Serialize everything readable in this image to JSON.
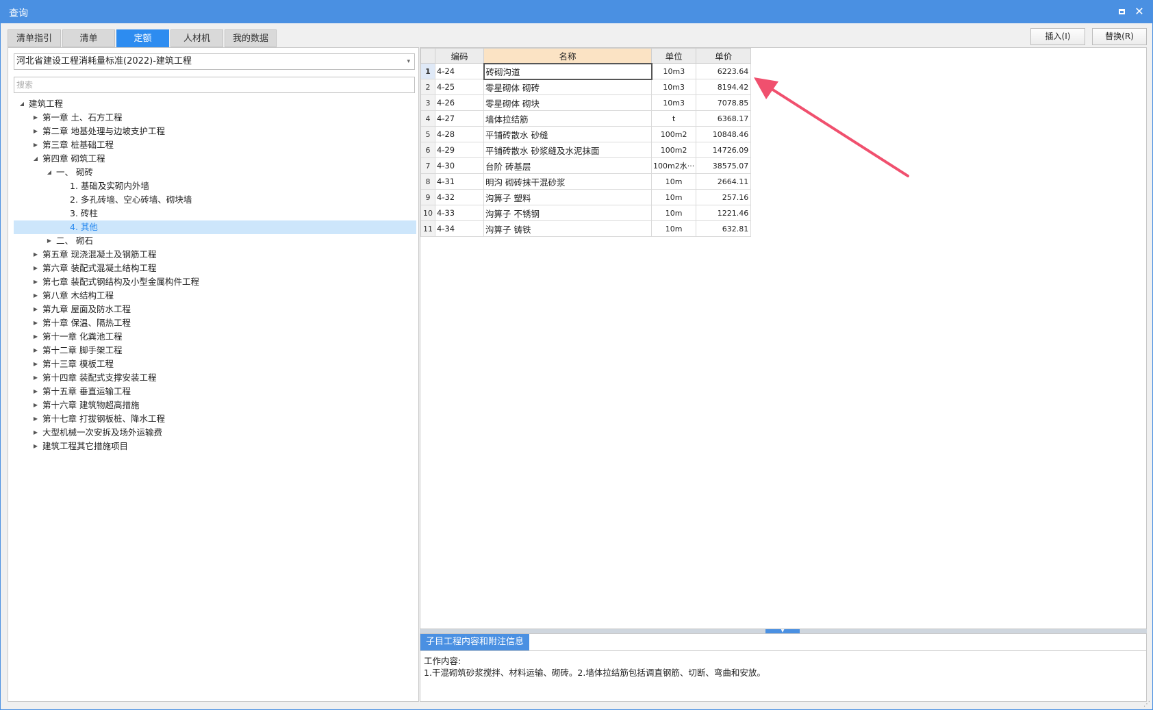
{
  "window": {
    "title": "查询",
    "maximize_glyph": "max-icon",
    "close_glyph": "✕"
  },
  "tabs": [
    "清单指引",
    "清单",
    "定额",
    "人材机",
    "我的数据"
  ],
  "active_tab_index": 2,
  "actions": {
    "insert_label": "插入(I)",
    "replace_label": "替换(R)"
  },
  "left": {
    "library": "河北省建设工程消耗量标准(2022)-建筑工程",
    "search_placeholder": "搜索",
    "tree": [
      {
        "label": "建筑工程",
        "level": 0,
        "state": "expanded"
      },
      {
        "label": "第一章 土、石方工程",
        "level": 1,
        "state": "collapsed"
      },
      {
        "label": "第二章 地基处理与边坡支护工程",
        "level": 1,
        "state": "collapsed"
      },
      {
        "label": "第三章 桩基础工程",
        "level": 1,
        "state": "collapsed"
      },
      {
        "label": "第四章 砌筑工程",
        "level": 1,
        "state": "expanded"
      },
      {
        "label": "一、 砌砖",
        "level": 2,
        "state": "expanded"
      },
      {
        "label": "1. 基础及实砌内外墙",
        "level": 3,
        "state": "leaf"
      },
      {
        "label": "2. 多孔砖墙、空心砖墙、砌块墙",
        "level": 3,
        "state": "leaf"
      },
      {
        "label": "3. 砖柱",
        "level": 3,
        "state": "leaf"
      },
      {
        "label": "4. 其他",
        "level": 3,
        "state": "leaf",
        "selected": true
      },
      {
        "label": "二、 砌石",
        "level": 2,
        "state": "collapsed"
      },
      {
        "label": "第五章 现浇混凝土及钢筋工程",
        "level": 1,
        "state": "collapsed"
      },
      {
        "label": "第六章 装配式混凝土结构工程",
        "level": 1,
        "state": "collapsed"
      },
      {
        "label": "第七章 装配式钢结构及小型金属构件工程",
        "level": 1,
        "state": "collapsed"
      },
      {
        "label": "第八章 木结构工程",
        "level": 1,
        "state": "collapsed"
      },
      {
        "label": "第九章 屋面及防水工程",
        "level": 1,
        "state": "collapsed"
      },
      {
        "label": "第十章 保温、隔热工程",
        "level": 1,
        "state": "collapsed"
      },
      {
        "label": "第十一章 化粪池工程",
        "level": 1,
        "state": "collapsed"
      },
      {
        "label": "第十二章 脚手架工程",
        "level": 1,
        "state": "collapsed"
      },
      {
        "label": "第十三章 模板工程",
        "level": 1,
        "state": "collapsed"
      },
      {
        "label": "第十四章 装配式支撑安装工程",
        "level": 1,
        "state": "collapsed"
      },
      {
        "label": "第十五章 垂直运输工程",
        "level": 1,
        "state": "collapsed"
      },
      {
        "label": "第十六章 建筑物超高措施",
        "level": 1,
        "state": "collapsed"
      },
      {
        "label": "第十七章 打拔钢板桩、降水工程",
        "level": 1,
        "state": "collapsed"
      },
      {
        "label": "大型机械一次安拆及场外运输费",
        "level": 1,
        "state": "collapsed"
      },
      {
        "label": "建筑工程其它措施项目",
        "level": 1,
        "state": "collapsed"
      }
    ]
  },
  "grid": {
    "columns": {
      "code": "编码",
      "name": "名称",
      "unit": "单位",
      "price": "单价"
    },
    "current_row": 1,
    "rows": [
      {
        "no": "1",
        "code": "4-24",
        "name": "砖砌沟道",
        "unit": "10m3",
        "price": "6223.64"
      },
      {
        "no": "2",
        "code": "4-25",
        "name": "零星砌体 砌砖",
        "unit": "10m3",
        "price": "8194.42"
      },
      {
        "no": "3",
        "code": "4-26",
        "name": "零星砌体 砌块",
        "unit": "10m3",
        "price": "7078.85"
      },
      {
        "no": "4",
        "code": "4-27",
        "name": "墙体拉结筋",
        "unit": "t",
        "price": "6368.17"
      },
      {
        "no": "5",
        "code": "4-28",
        "name": "平铺砖散水 砂缝",
        "unit": "100m2",
        "price": "10848.46"
      },
      {
        "no": "6",
        "code": "4-29",
        "name": "平铺砖散水 砂浆缝及水泥抹面",
        "unit": "100m2",
        "price": "14726.09"
      },
      {
        "no": "7",
        "code": "4-30",
        "name": "台阶 砖基层",
        "unit": "100m2水···",
        "price": "38575.07"
      },
      {
        "no": "8",
        "code": "4-31",
        "name": "明沟 砌砖抹干混砂浆",
        "unit": "10m",
        "price": "2664.11"
      },
      {
        "no": "9",
        "code": "4-32",
        "name": "沟箅子 塑料",
        "unit": "10m",
        "price": "257.16"
      },
      {
        "no": "10",
        "code": "4-33",
        "name": "沟箅子 不锈钢",
        "unit": "10m",
        "price": "1221.46"
      },
      {
        "no": "11",
        "code": "4-34",
        "name": "沟箅子 铸铁",
        "unit": "10m",
        "price": "632.81"
      }
    ]
  },
  "detail": {
    "tab_label": "子目工程内容和附注信息",
    "heading": "工作内容:",
    "text": "1.干混砌筑砂浆搅拌、材料运输、砌砖。2.墙体拉结筋包括调直钢筋、切断、弯曲和安放。"
  },
  "annotation": {
    "color": "#f0506e"
  }
}
